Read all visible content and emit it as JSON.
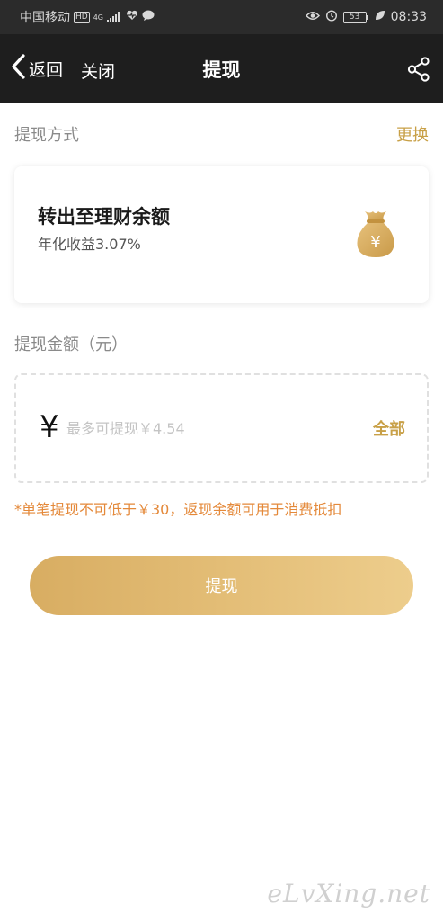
{
  "status_bar": {
    "carrier": "中国移动",
    "hd_badge": "HD",
    "network": "4G",
    "battery": "53",
    "time": "08:33"
  },
  "nav": {
    "back_label": "返回",
    "close_label": "关闭",
    "title": "提现"
  },
  "method_section": {
    "title": "提现方式",
    "change_label": "更换",
    "card": {
      "name": "转出至理财余额",
      "rate_text": "年化收益3.07%",
      "icon": "money-bag-icon"
    }
  },
  "amount_section": {
    "title": "提现金额（元）",
    "currency_symbol": "¥",
    "input_value": "",
    "input_placeholder": "最多可提现￥4.54",
    "all_label": "全部"
  },
  "notice": "*单笔提现不可低于￥30，返现余额可用于消费抵扣",
  "submit_label": "提现",
  "watermark": "eLvXing.net",
  "colors": {
    "accent_gold": "#c8a047",
    "notice_orange": "#e4893a",
    "nav_bg": "#1e1e1e",
    "button_gradient_start": "#d8ad62",
    "button_gradient_end": "#edcd8c"
  }
}
